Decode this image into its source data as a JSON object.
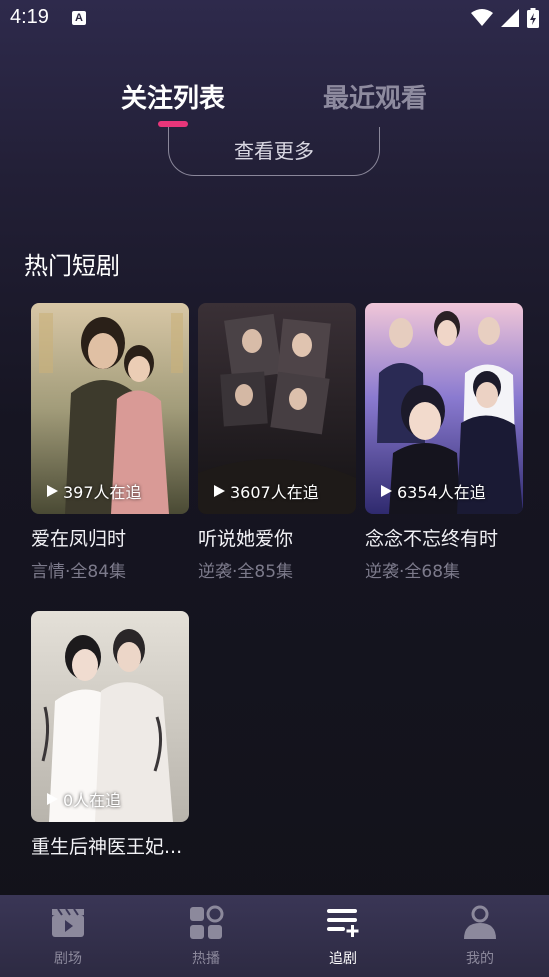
{
  "status": {
    "time": "4:19",
    "notif_icon": "A"
  },
  "tabs": [
    {
      "label": "关注列表",
      "active": true
    },
    {
      "label": "最近观看",
      "active": false
    }
  ],
  "more_button": "查看更多",
  "section_title": "热门短剧",
  "dramas": [
    {
      "title": "爱在凤归时",
      "meta": "言情·全84集",
      "watchers": "397人在追",
      "colors": [
        "#4a4a34",
        "#a29c7a",
        "#d8c7a6"
      ]
    },
    {
      "title": "听说她爱你",
      "meta": "逆袭·全85集",
      "watchers": "3607人在追",
      "colors": [
        "#141214",
        "#3a3036",
        "#c8b98c"
      ]
    },
    {
      "title": "念念不忘终有时",
      "meta": "逆袭·全68集",
      "watchers": "6354人在追",
      "colors": [
        "#2f2a6e",
        "#8a7ad0",
        "#f0c6d8"
      ]
    },
    {
      "title": "重生后神医王妃...",
      "meta": "",
      "watchers": "0人在追",
      "colors": [
        "#b8b4ac",
        "#e4e0d8",
        "#f4f2ee"
      ]
    }
  ],
  "nav": [
    {
      "label": "剧场",
      "icon": "clapperboard-icon",
      "active": false
    },
    {
      "label": "热播",
      "icon": "grid-icon",
      "active": false
    },
    {
      "label": "追剧",
      "icon": "playlist-add-icon",
      "active": true
    },
    {
      "label": "我的",
      "icon": "person-icon",
      "active": false
    }
  ]
}
